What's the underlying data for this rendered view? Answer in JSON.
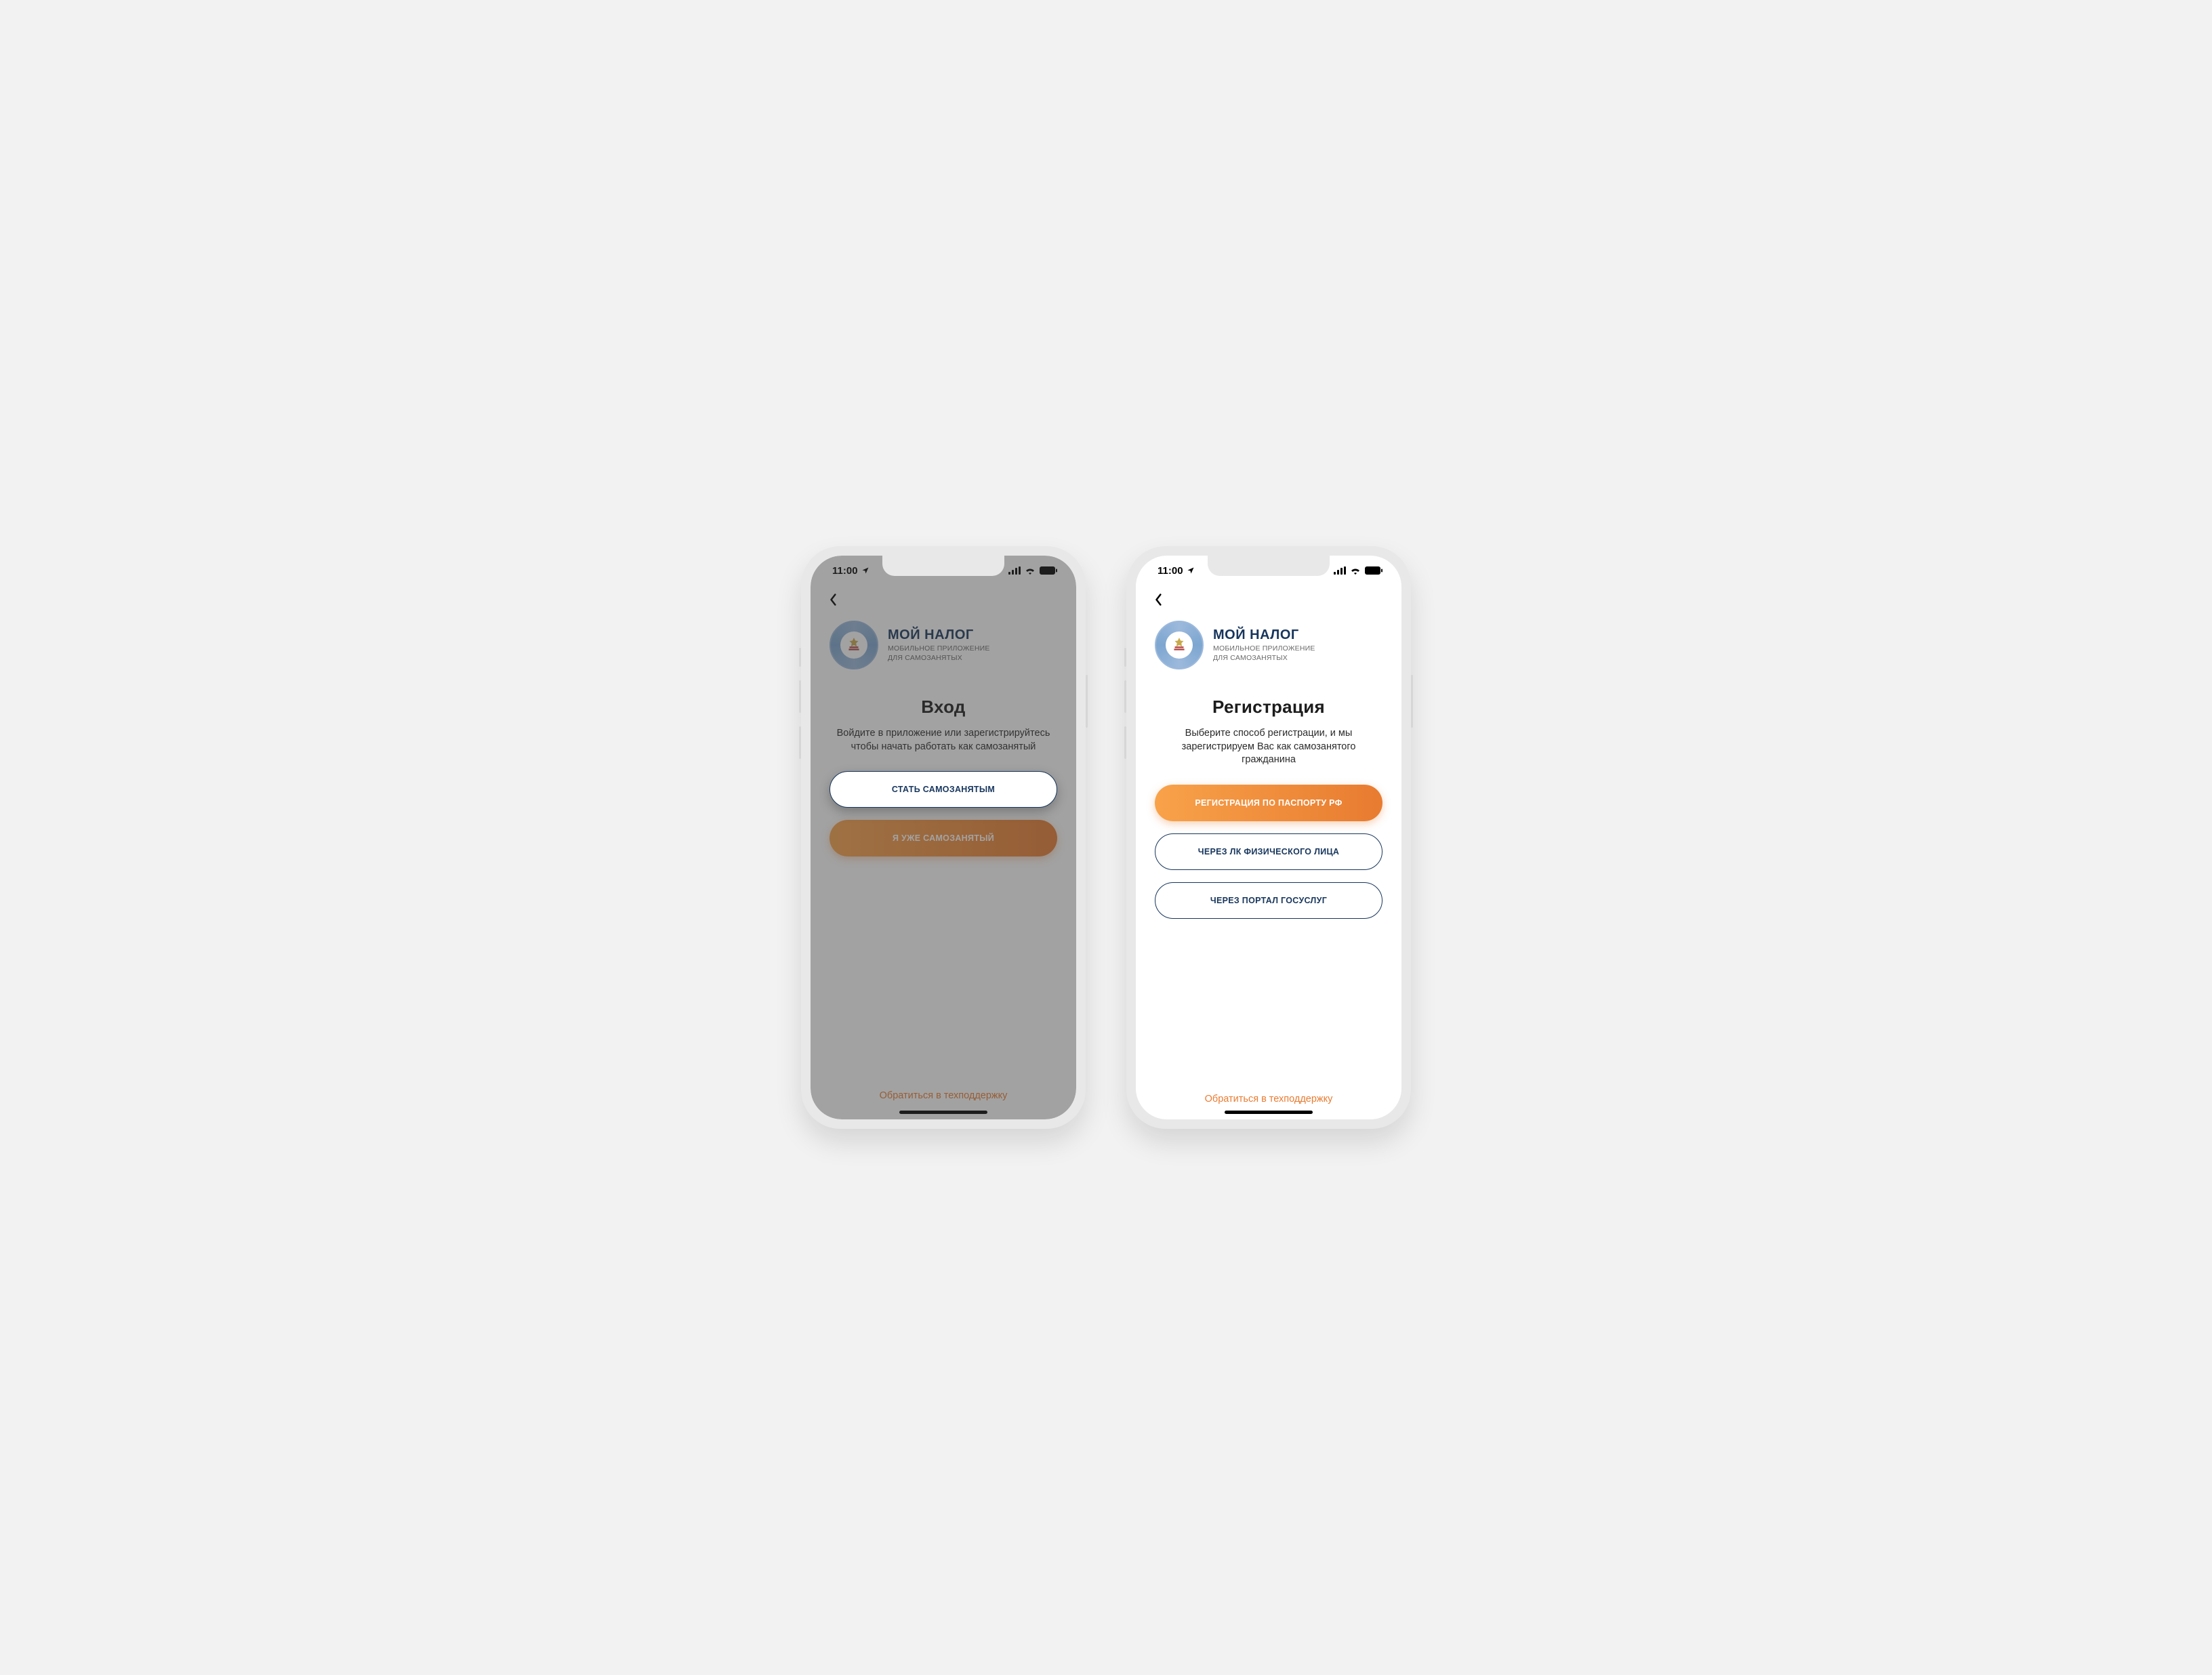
{
  "status": {
    "time": "11:00"
  },
  "brand": {
    "title": "МОЙ НАЛОГ",
    "subtitle_line1": "МОБИЛЬНОЕ ПРИЛОЖЕНИЕ",
    "subtitle_line2": "ДЛЯ САМОЗАНЯТЫХ"
  },
  "support_label": "Обратиться в техподдержку",
  "left": {
    "title": "Вход",
    "desc": "Войдите в приложение или зарегистрируйтесь чтобы начать работать как самозанятый",
    "btn_primary": "СТАТЬ САМОЗАНЯТЫМ",
    "btn_secondary": "Я УЖЕ САМОЗАНЯТЫЙ"
  },
  "right": {
    "title": "Регистрация",
    "desc": "Выберите способ регистрации, и мы зарегистрируем Вас как самозанятого гражданина",
    "btn1": "РЕГИСТРАЦИЯ ПО ПАСПОРТУ РФ",
    "btn2": "ЧЕРЕЗ ЛК ФИЗИЧЕСКОГО ЛИЦА",
    "btn3": "ЧЕРЕЗ ПОРТАЛ ГОСУСЛУГ"
  },
  "colors": {
    "brand_blue": "#17365d",
    "orange_start": "#f8a24a",
    "orange_end": "#e87b30",
    "support": "#ea7b30"
  }
}
